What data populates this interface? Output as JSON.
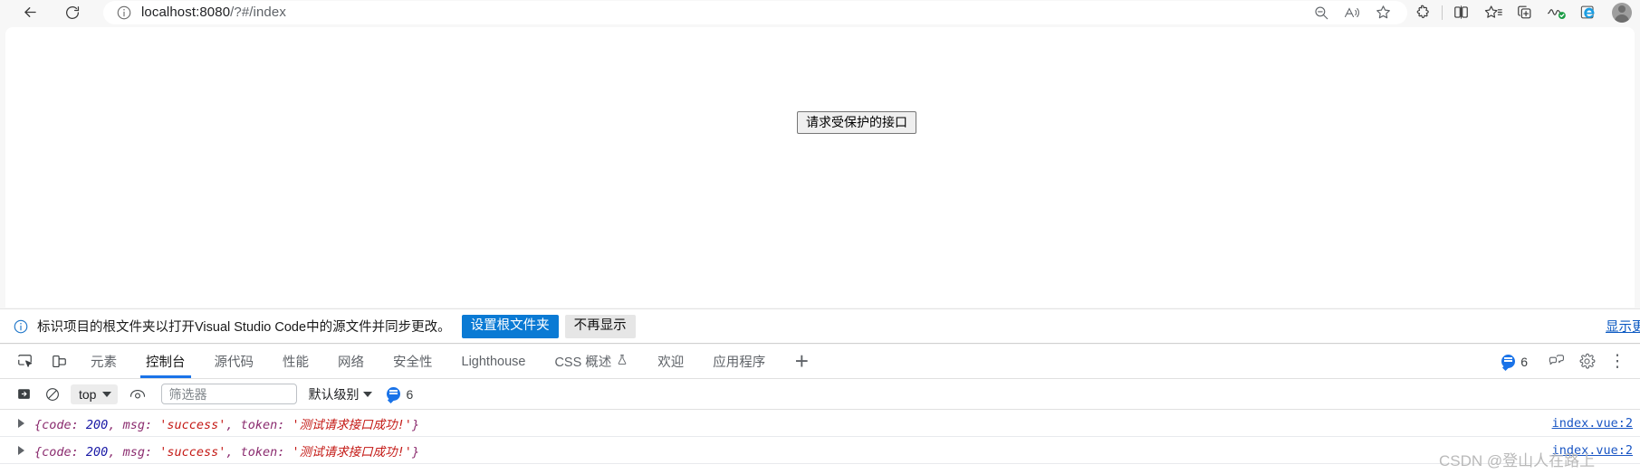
{
  "browser": {
    "back_icon": "back-arrow-icon",
    "reload_icon": "reload-icon",
    "info_icon": "site-info-icon",
    "url_host": "localhost:8080",
    "url_path": "/?#/index",
    "url_full": "localhost:8080/?#/index",
    "address_actions": [
      "zoom-out-icon",
      "read-aloud-icon",
      "favorite-star-icon"
    ],
    "toolbar_icons": [
      "extensions-puzzle-icon",
      "split-screen-icon",
      "collections-star-icon",
      "add-to-collection-icon",
      "browser-essentials-icon",
      "internet-explorer-mode-icon"
    ],
    "profile": "user-avatar"
  },
  "page": {
    "button_label": "请求受保护的接口"
  },
  "vscode_bar": {
    "info_icon": "info-circle-icon",
    "message": "标识项目的根文件夹以打开Visual Studio Code中的源文件并同步更改。",
    "primary_button": "设置根文件夹",
    "secondary_button": "不再显示",
    "more_link": "显示更多"
  },
  "devtools": {
    "inspect_icon": "inspect-element-icon",
    "device_icon": "device-toolbar-icon",
    "tabs": [
      {
        "label": "元素",
        "active": false,
        "icon": null
      },
      {
        "label": "控制台",
        "active": true,
        "icon": null
      },
      {
        "label": "源代码",
        "active": false,
        "icon": null
      },
      {
        "label": "性能",
        "active": false,
        "icon": null
      },
      {
        "label": "网络",
        "active": false,
        "icon": null
      },
      {
        "label": "安全性",
        "active": false,
        "icon": null
      },
      {
        "label": "Lighthouse",
        "active": false,
        "icon": null
      },
      {
        "label": "CSS 概述",
        "active": false,
        "icon": "experiment-flask-icon"
      },
      {
        "label": "欢迎",
        "active": false,
        "icon": null
      },
      {
        "label": "应用程序",
        "active": false,
        "icon": null
      }
    ],
    "add_tab_label": "+",
    "message_count": "6",
    "feedback_icon": "feedback-icon",
    "settings_icon": "gear-icon",
    "kebab_icon": "more-options-icon",
    "console_toolbar": {
      "sidebar_icon": "console-sidebar-icon",
      "clear_icon": "clear-console-icon",
      "context": "top",
      "eye_icon": "live-expression-icon",
      "filter_placeholder": "筛选器",
      "filter_value": "",
      "level": "默认级别",
      "message_count": "6"
    },
    "console_rows": [
      {
        "expand_icon": "expand-triangle-icon",
        "parts": {
          "open": "{",
          "code_key": "code: ",
          "code_value": "200",
          "sep1": ", ",
          "msg_key": "msg: ",
          "msg_value": "'success'",
          "sep2": ", ",
          "token_key": "token: ",
          "token_value": "'测试请求接口成功!'",
          "close": "}"
        },
        "source": "index.vue:2"
      },
      {
        "expand_icon": "expand-triangle-icon",
        "parts": {
          "open": "{",
          "code_key": "code: ",
          "code_value": "200",
          "sep1": ", ",
          "msg_key": "msg: ",
          "msg_value": "'success'",
          "sep2": ", ",
          "token_key": "token: ",
          "token_value": "'测试请求接口成功!'",
          "close": "}"
        },
        "source": "index.vue:2"
      }
    ]
  },
  "watermark": "CSDN @登山人在路上",
  "colors": {
    "accent_blue": "#1a73e8",
    "vscode_button_blue": "#0a7ad4",
    "link_blue": "#0a58c2",
    "page_white": "#ffffff",
    "chrome_gray": "#f7f7f7"
  }
}
